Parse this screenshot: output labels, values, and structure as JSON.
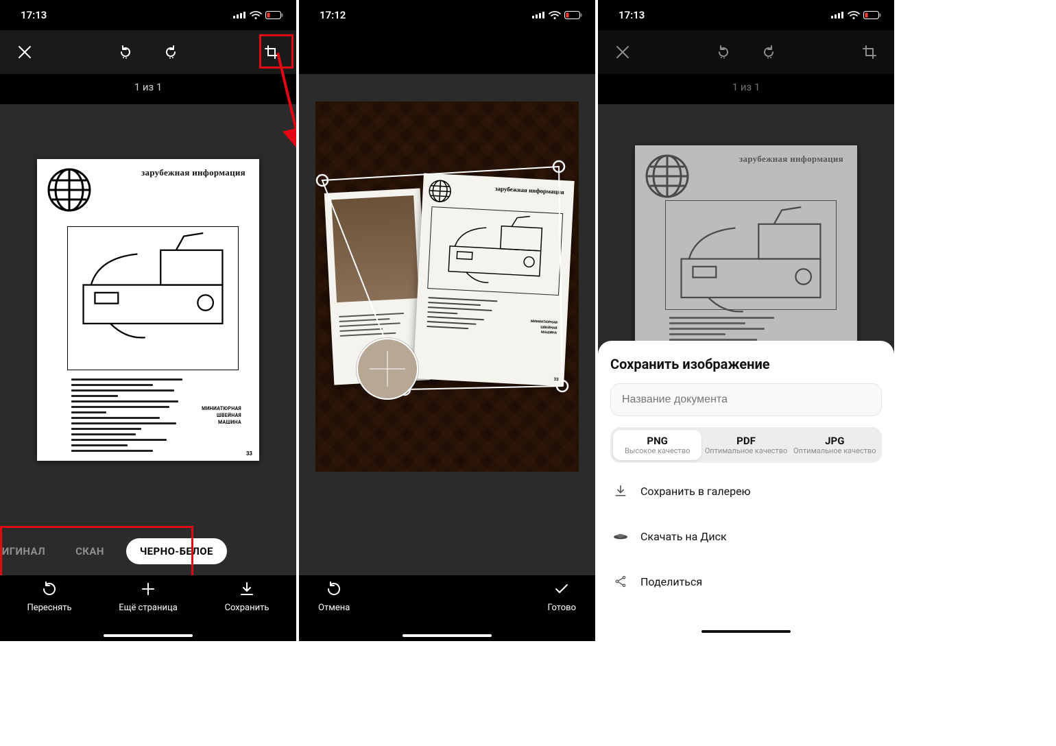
{
  "statusbar": {
    "time1": "17:13",
    "time2": "17:12",
    "time3": "17:13"
  },
  "counter": {
    "text": "1 из 1"
  },
  "document": {
    "heading": "зарубежная информация",
    "sidetag_line1": "МИНИАТЮРНАЯ",
    "sidetag_line2": "ШВЕЙНАЯ",
    "sidetag_line3": "МАШИНА",
    "pagenum": "33"
  },
  "filters": {
    "opt_original": "ОРИГИНАЛ",
    "opt_scan": "СКАН",
    "opt_bw": "ЧЕРНО-БЕЛОЕ"
  },
  "actions": {
    "retake": "Переснять",
    "add": "Ещё страница",
    "save": "Сохранить",
    "cancel": "Отмена",
    "done": "Готово"
  },
  "sheet": {
    "title": "Сохранить изображение",
    "placeholder": "Название документа",
    "fmt_png": "PNG",
    "fmt_png_sub": "Высокое\nкачество",
    "fmt_pdf": "PDF",
    "fmt_pdf_sub": "Оптимальное\nкачество",
    "fmt_jpg": "JPG",
    "fmt_jpg_sub": "Оптимальное\nкачество",
    "row_gallery": "Сохранить в галерею",
    "row_disk": "Скачать на Диск",
    "row_share": "Поделиться"
  }
}
